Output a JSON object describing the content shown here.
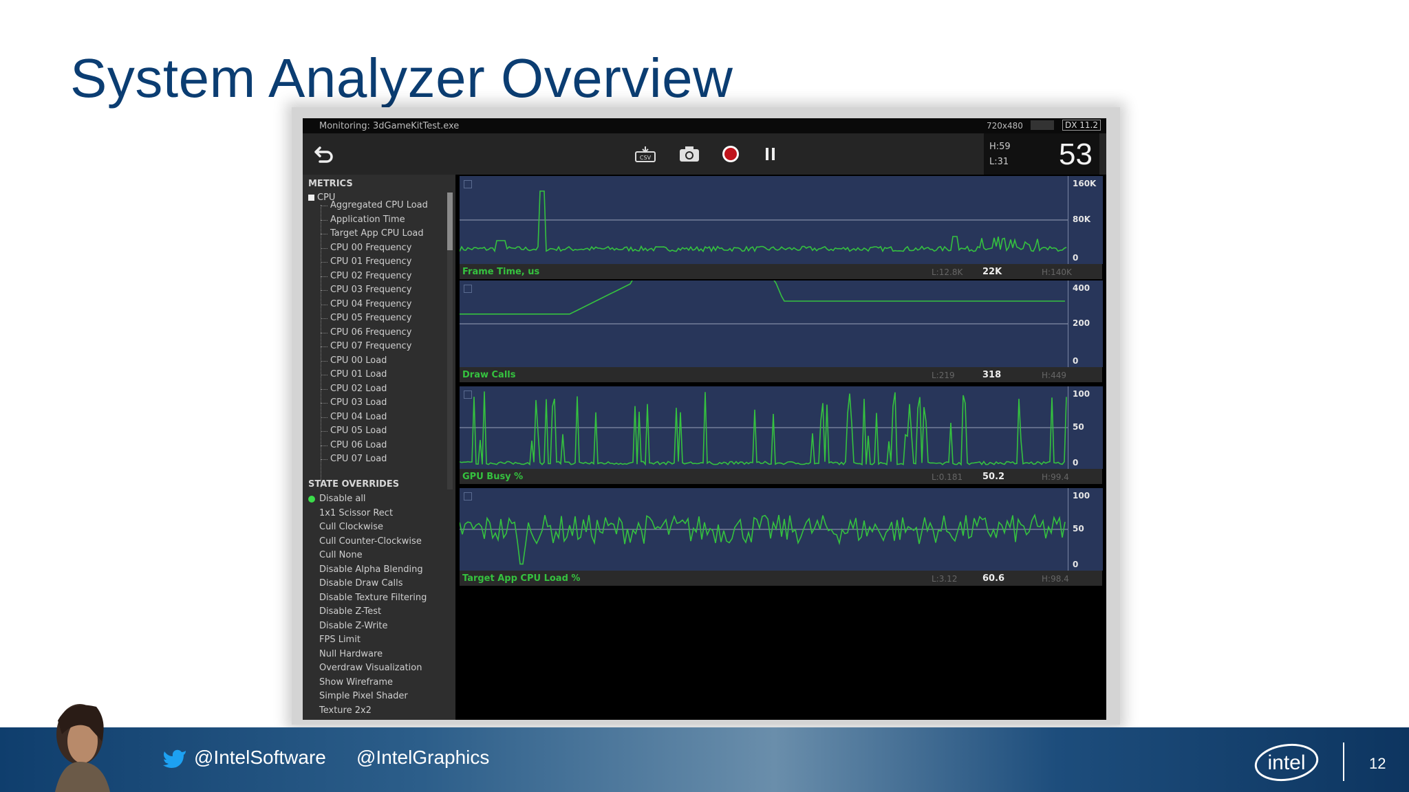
{
  "slide": {
    "title": "System Analyzer Overview",
    "page_number": "12"
  },
  "app": {
    "monitoring_label": "Monitoring: 3dGameKitTest.exe",
    "resolution": "720x480",
    "api": "DX 11.2",
    "fps": {
      "high": "H:59",
      "low": "L:31",
      "current": "53"
    },
    "toolbar_icons": [
      "back-icon",
      "csv-export-icon",
      "camera-icon",
      "record-icon",
      "pause-icon"
    ],
    "toolbar_csv_label": "CSV"
  },
  "sidebar": {
    "metrics_header": "METRICS",
    "cpu_group": "CPU",
    "metrics": [
      "Aggregated CPU Load",
      "Application Time",
      "Target App CPU Load",
      "CPU 00 Frequency",
      "CPU 01 Frequency",
      "CPU 02 Frequency",
      "CPU 03 Frequency",
      "CPU 04 Frequency",
      "CPU 05 Frequency",
      "CPU 06 Frequency",
      "CPU 07 Frequency",
      "CPU 00 Load",
      "CPU 01 Load",
      "CPU 02 Load",
      "CPU 03 Load",
      "CPU 04 Load",
      "CPU 05 Load",
      "CPU 06 Load",
      "CPU 07 Load"
    ],
    "overrides_header": "STATE OVERRIDES",
    "overrides": [
      "Disable all",
      "1x1 Scissor Rect",
      "Cull Clockwise",
      "Cull Counter-Clockwise",
      "Cull None",
      "Disable Alpha Blending",
      "Disable Draw Calls",
      "Disable Texture Filtering",
      "Disable Z-Test",
      "Disable Z-Write",
      "FPS Limit",
      "Null Hardware",
      "Overdraw Visualization",
      "Show Wireframe",
      "Simple Pixel Shader",
      "Texture 2x2"
    ],
    "selected_override": "Disable all"
  },
  "charts": [
    {
      "name": "Frame Time, us",
      "ticks": [
        "160K",
        "80K",
        "0"
      ],
      "low": "L:12.8K",
      "current": "22K",
      "high": "H:140K"
    },
    {
      "name": "Draw Calls",
      "ticks": [
        "400",
        "200",
        "0"
      ],
      "low": "L:219",
      "current": "318",
      "high": "H:449"
    },
    {
      "name": "GPU Busy %",
      "ticks": [
        "100",
        "50",
        "0"
      ],
      "low": "L:0.181",
      "current": "50.2",
      "high": "H:99.4"
    },
    {
      "name": "Target App CPU Load %",
      "ticks": [
        "100",
        "50",
        "0"
      ],
      "low": "L:3.12",
      "current": "60.6",
      "high": "H:98.4"
    }
  ],
  "footer": {
    "twitter_handle_1": "@IntelSoftware",
    "twitter_handle_2": "@IntelGraphics",
    "logo_text": "intel"
  },
  "colors": {
    "title": "#0b3d72",
    "plot_bg": "#28365a",
    "series": "#35c23f",
    "footer": "#1d4d7c"
  }
}
